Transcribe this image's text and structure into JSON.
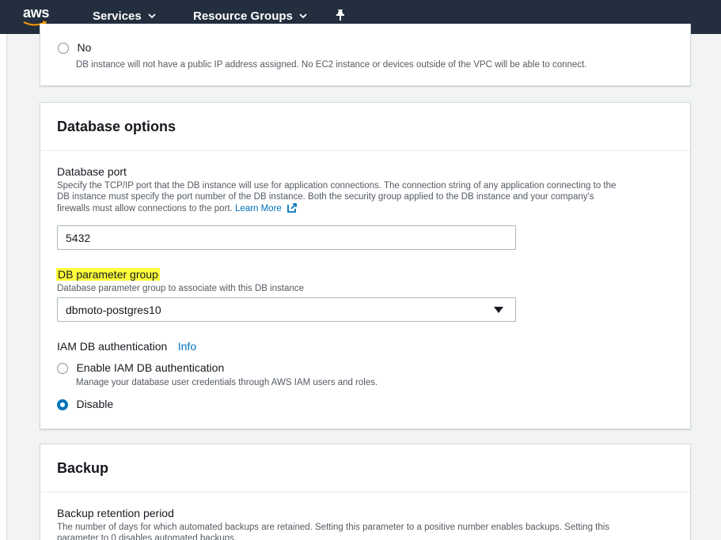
{
  "nav": {
    "logo": "aws",
    "services": "Services",
    "resource_groups": "Resource Groups",
    "chevron": "⌄"
  },
  "public_access": {
    "no_label": "No",
    "no_desc": "DB instance will not have a public IP address assigned. No EC2 instance or devices outside of the VPC will be able to connect."
  },
  "database_options": {
    "title": "Database options",
    "port": {
      "label": "Database port",
      "desc_line1": "Specify the TCP/IP port that the DB instance will use for application connections. The connection string of any application connecting to the",
      "desc_line2": "DB instance must specify the port number of the DB instance. Both the security group applied to the DB instance and your company's",
      "desc_line3": "firewalls must allow connections to the port.",
      "learn_more": "Learn More",
      "value": "5432"
    },
    "param_group": {
      "label": "DB parameter group",
      "desc": "Database parameter group to associate with this DB instance",
      "selected": "dbmoto-postgres10"
    },
    "iam": {
      "label": "IAM DB authentication",
      "info": "Info",
      "enable_label": "Enable IAM DB authentication",
      "enable_desc": "Manage your database user credentials through AWS IAM users and roles.",
      "disable_label": "Disable",
      "selected": "Disable"
    }
  },
  "backup": {
    "title": "Backup",
    "retention_label": "Backup retention period",
    "retention_desc_line1": "The number of days for which automated backups are retained. Setting this parameter to a positive number enables backups. Setting this",
    "retention_desc_line2": "parameter to 0 disables automated backups."
  },
  "colors": {
    "navbar": "#232f3e",
    "accent": "#0073bb",
    "highlight": "#ffff3c"
  }
}
